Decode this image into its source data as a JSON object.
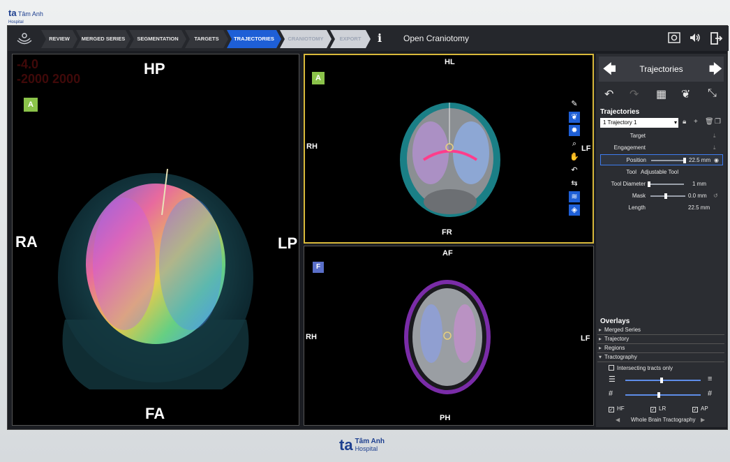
{
  "bezel": {
    "logo_mark": "ta",
    "logo_name": "Tâm Anh",
    "logo_sub": "Hospital"
  },
  "topbar": {
    "steps": [
      {
        "label": "REVIEW",
        "state": "done"
      },
      {
        "label": "MERGED SERIES",
        "state": "done"
      },
      {
        "label": "SEGMENTATION",
        "state": "done"
      },
      {
        "label": "TARGETS",
        "state": "done"
      },
      {
        "label": "TRAJECTORIES",
        "state": "active"
      },
      {
        "label": "CRANIOTOMY",
        "state": "disabled"
      },
      {
        "label": "EXPORT",
        "state": "disabled"
      }
    ],
    "info_icon": "info-icon",
    "mode_title": "Open Craniotomy",
    "right_icons": [
      "screenshot-icon",
      "volume-icon",
      "exit-icon"
    ]
  },
  "view3d": {
    "badge": "A",
    "top": "HP",
    "left": "RA",
    "right": "LP",
    "bottom": "FA",
    "overlay_red_text_1": "-4.0",
    "overlay_red_text_2": "-2000 2000"
  },
  "view_coronal": {
    "badge": "A",
    "top": "HL",
    "left": "RH",
    "right": "LF",
    "bottom": "FR"
  },
  "view_axial": {
    "badge": "F",
    "top": "AF",
    "left": "RH",
    "right": "LF",
    "bottom": "PH"
  },
  "panel": {
    "title": "Trajectories",
    "section_trajectories": "Trajectories",
    "trajectory_select": "1 Trajectory 1",
    "props": {
      "target": "Target",
      "engagement": "Engagement",
      "position_label": "Position",
      "position_value": "22.5 mm",
      "tool_label": "Tool",
      "tool_value": "Adjustable Tool",
      "diameter_label": "Tool Diameter",
      "diameter_value": "1 mm",
      "mask_label": "Mask",
      "mask_value": "0.0 mm",
      "length_label": "Length",
      "length_value": "22.5 mm"
    },
    "overlays_title": "Overlays",
    "overlays": [
      "Merged Series",
      "Trajectory",
      "Regions",
      "Tractography"
    ],
    "intersect_label": "Intersecting tracts only",
    "axes": {
      "hf": "HF",
      "lr": "LR",
      "ap": "AP"
    },
    "tracto_preset": "Whole Brain Tractography"
  },
  "bottom_logo": {
    "mark": "ta",
    "name": "Tâm Anh",
    "sub": "Hospital"
  }
}
